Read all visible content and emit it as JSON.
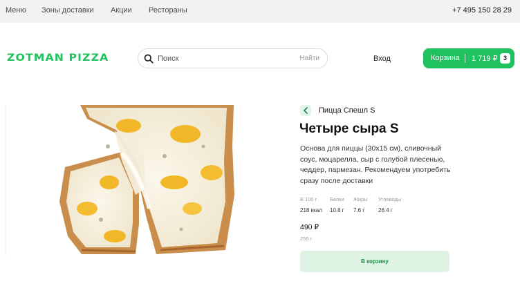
{
  "topnav": {
    "items": [
      "Меню",
      "Зоны доставки",
      "Акции",
      "Рестораны"
    ],
    "phone": "+7 495 150 28 29"
  },
  "header": {
    "logo": "ZOTMAN PIZZA",
    "search": {
      "placeholder": "Поиск",
      "button": "Найти"
    },
    "login": "Вход",
    "cart": {
      "label": "Корзина",
      "sum": "1 719 ₽",
      "count": "3"
    }
  },
  "colors": {
    "brand": "#1fc25f",
    "button_bg": "#def3e4",
    "button_text": "#1f8a45",
    "topbar_bg": "#f2f2f0"
  },
  "product": {
    "breadcrumb": "Пицца Спешл S",
    "title": "Четыре сыра S",
    "description": "Основа для пиццы (30x15 см), сливочный соус, моцарелла, сыр с голубой плесенью, чеддер, пармезан. Рекомендуем употребить сразу после доставки",
    "nutrition": [
      {
        "label": "В 100 г",
        "value": "218 ккал"
      },
      {
        "label": "Белки",
        "value": "10.8 г"
      },
      {
        "label": "Жиры",
        "value": "7.6 г"
      },
      {
        "label": "Углеводы",
        "value": "26.4 г"
      }
    ],
    "price": "490 ₽",
    "weight": "255 г",
    "add_button": "В корзину"
  }
}
